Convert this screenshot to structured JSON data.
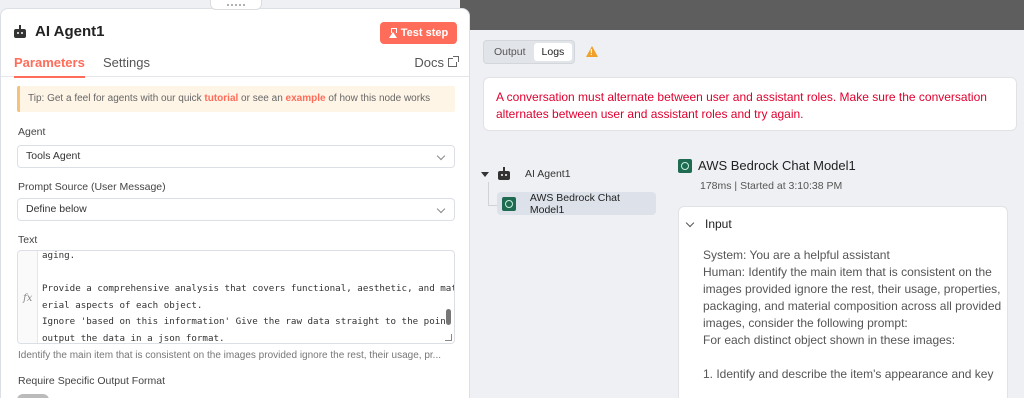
{
  "node": {
    "title": "AI Agent1",
    "test_step": "Test step",
    "tabs": [
      "Parameters",
      "Settings"
    ],
    "docs": "Docs",
    "tip": {
      "pre": "Tip: Get a feel for agents with our quick ",
      "link1": "tutorial",
      "mid": " or see an ",
      "link2": "example",
      "post": " of how this node works"
    },
    "agent_label": "Agent",
    "agent_value": "Tools Agent",
    "prompt_source_label": "Prompt Source (User Message)",
    "prompt_source_value": "Define below",
    "text_label": "Text",
    "text_lines": [
      "aging.",
      "",
      "Provide a comprehensive analysis that covers functional, aesthetic, and mat",
      "erial aspects of each object.",
      "Ignore 'based on this information' Give the raw data straight to the point",
      "output the data in a json format."
    ],
    "fx": "fx",
    "text_hint": "Identify the main item that is consistent on the images provided ignore the rest, their usage, pr...",
    "output_format_label": "Require Specific Output Format"
  },
  "output_panel": {
    "tabs": [
      "Output",
      "Logs"
    ],
    "active_tab": "Logs",
    "error": "A conversation must alternate between user and assistant roles. Make sure the conversation alternates between user and assistant roles and try again.",
    "tree": {
      "root": "AI Agent1",
      "child": "AWS Bedrock Chat Model1"
    },
    "detail": {
      "title": "AWS Bedrock Chat Model1",
      "meta": "178ms | Started at 3:10:38 PM",
      "input_label": "Input",
      "input_lines": [
        "System: You are a helpful assistant",
        "Human: Identify the main item that is consistent on the images provided ignore the rest, their usage, properties, packaging, and material composition across all provided images, consider the following prompt:",
        "For each distinct object shown in these images:",
        "",
        "1. Identify and describe the item's appearance and key"
      ]
    }
  }
}
